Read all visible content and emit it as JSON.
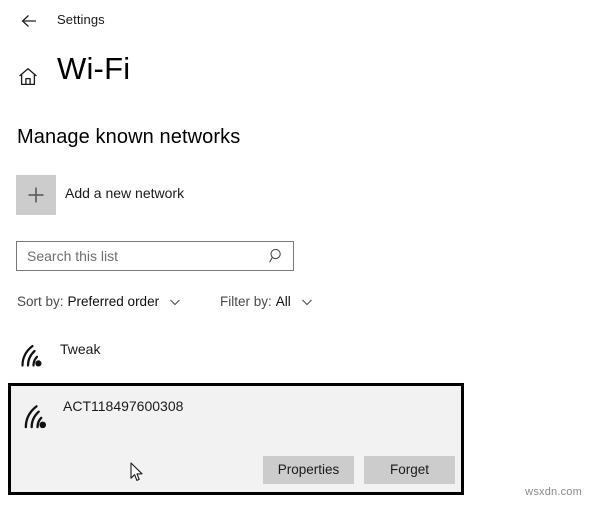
{
  "window": {
    "app_title": "Settings",
    "back_icon": "back-arrow-icon"
  },
  "header": {
    "home_icon": "home-icon",
    "page_title": "Wi-Fi"
  },
  "main": {
    "section_heading": "Manage known networks",
    "add_network": {
      "label": "Add a new network",
      "icon": "plus-icon"
    },
    "search": {
      "placeholder": "Search this list",
      "value": "",
      "icon": "search-icon"
    },
    "sort": {
      "label": "Sort by:",
      "value": "Preferred order",
      "chevron": "chevron-down-icon"
    },
    "filter": {
      "label": "Filter by:",
      "value": "All",
      "chevron": "chevron-down-icon"
    },
    "networks": [
      {
        "name": "Tweak",
        "icon": "wifi-signal-icon",
        "selected": false
      },
      {
        "name": "ACT118497600308",
        "icon": "wifi-signal-icon",
        "selected": true,
        "actions": {
          "properties_label": "Properties",
          "forget_label": "Forget"
        }
      }
    ]
  },
  "overlay": {
    "watermark": "wsxdn.com",
    "cursor_icon": "mouse-pointer-icon"
  },
  "colors": {
    "page_background": "#ffffff",
    "selected_item_background": "#f2f2f2",
    "selection_border": "#000000",
    "button_background": "#cccccc",
    "tile_background": "#cccccc",
    "input_border": "#7a7a7a",
    "muted_text": "#4a4a4a"
  }
}
